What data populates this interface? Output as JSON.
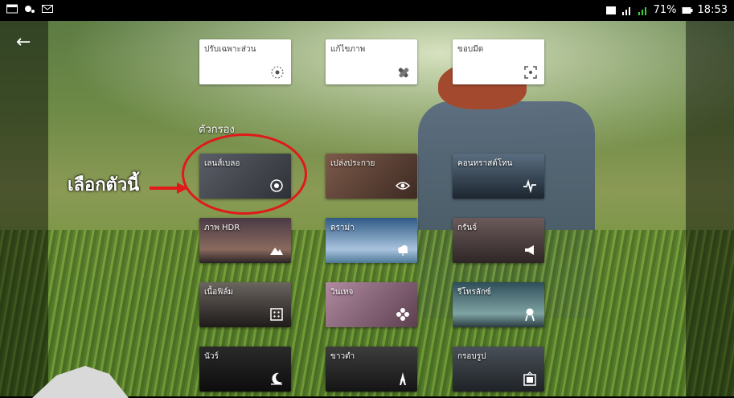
{
  "status_bar": {
    "battery": "71%",
    "time": "18:53"
  },
  "tools": [
    {
      "label": "ปรับเฉพาะส่วน",
      "icon": "target-dot-icon"
    },
    {
      "label": "แก้ไขภาพ",
      "icon": "bandage-icon"
    },
    {
      "label": "ขอบมีด",
      "icon": "crop-frame-icon"
    }
  ],
  "section_title": "ตัวกรอง",
  "filters": [
    {
      "label": "เลนส์เบลอ",
      "icon": "target-icon",
      "bg": "#4a4f58"
    },
    {
      "label": "เปล่งประกาย",
      "icon": "eye-icon",
      "bg": "#6b4a3c"
    },
    {
      "label": "คอนทราสต์โทน",
      "icon": "pulse-icon",
      "bg": "#2b3b4a"
    },
    {
      "label": "ภาพ HDR",
      "icon": "mountain-icon",
      "bg": "#3a2f36"
    },
    {
      "label": "ดราม่า",
      "icon": "cloud-icon",
      "bg": "#496d90"
    },
    {
      "label": "กรันจ์",
      "icon": "megaphone-icon",
      "bg": "#4a3a3a"
    },
    {
      "label": "เนื้อฟิล์ม",
      "icon": "film-grain-icon",
      "bg": "#3a3533"
    },
    {
      "label": "วินเทจ",
      "icon": "flower-icon",
      "bg": "#7b5b6b"
    },
    {
      "label": "รีโทรลักซ์",
      "icon": "badge-pin-icon",
      "bg": "#3f5e66"
    },
    {
      "label": "นัวร์",
      "icon": "moon-icon",
      "bg": "#1e1e1e"
    },
    {
      "label": "ขาวดำ",
      "icon": "eiffel-icon",
      "bg": "#2d2d2d"
    },
    {
      "label": "กรอบรูป",
      "icon": "frame-icon",
      "bg": "#3a3f44"
    }
  ],
  "annotation": {
    "text": "เลือกตัวนี้",
    "color": "#e01919"
  }
}
